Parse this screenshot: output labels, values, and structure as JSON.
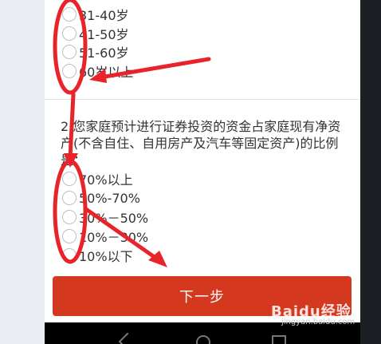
{
  "q1": {
    "options": [
      "31-40岁",
      "41-50岁",
      "51-60岁",
      "60岁以上"
    ]
  },
  "q2": {
    "question": "2.您家庭预计进行证券投资的资金占家庭现有净资产(不含自住、自用房产及汽车等固定资产)的比例是：",
    "options": [
      "70%以上",
      "50%-70%",
      "30%－50%",
      "10%－30%",
      "10%以下"
    ]
  },
  "next_label": "下一步",
  "watermark": {
    "brand": "Baidu经验",
    "url": "jingyan.baidu.com"
  },
  "colors": {
    "button": "#d4381e",
    "annotation": "#e8242a"
  }
}
